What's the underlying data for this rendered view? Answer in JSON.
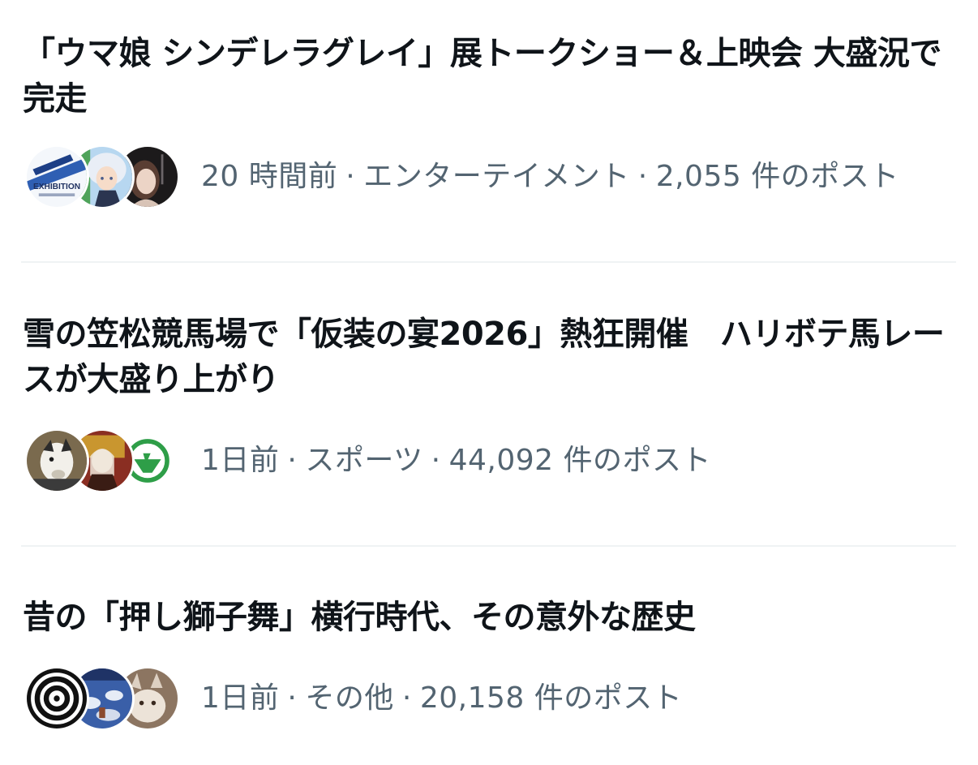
{
  "items": [
    {
      "headline": "「ウマ娘 シンデレラグレイ」展トークショー＆上映会 大盛況で完走",
      "time": "20 時間前",
      "category": "エンターテイメント",
      "posts": "2,055 件のポスト",
      "avatars": [
        {
          "icon": "exhibition-poster-avatar",
          "text": "EXHIBITION"
        },
        {
          "icon": "anime-character-avatar"
        },
        {
          "icon": "person-photo-avatar"
        }
      ]
    },
    {
      "headline": "雪の笠松競馬場で「仮装の宴2026」熱狂開催　ハリボテ馬レースが大盛り上がり",
      "time": "1日前",
      "category": "スポーツ",
      "posts": "44,092 件のポスト",
      "avatars": [
        {
          "icon": "cartoon-horse-avatar"
        },
        {
          "icon": "costumed-person-avatar"
        },
        {
          "icon": "green-logo-avatar"
        }
      ]
    },
    {
      "headline": "昔の「押し獅子舞」横行時代、その意外な歴史",
      "time": "1日前",
      "category": "その他",
      "posts": "20,158 件のポスト",
      "avatars": [
        {
          "icon": "spiral-avatar"
        },
        {
          "icon": "album-cover-avatar"
        },
        {
          "icon": "animal-photo-avatar"
        }
      ]
    }
  ],
  "separator": "·",
  "colors": {
    "headline": "#0f1419",
    "meta": "#536471",
    "divider": "#eff3f4",
    "background": "#ffffff"
  }
}
